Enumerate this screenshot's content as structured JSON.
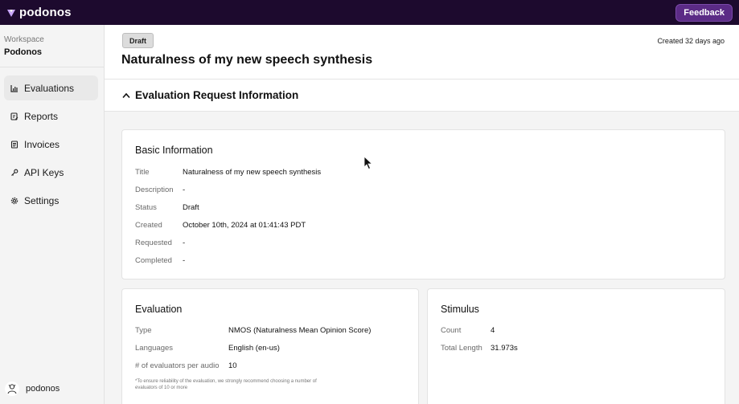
{
  "app": {
    "logo_text": "podonos",
    "feedback_label": "Feedback"
  },
  "sidebar": {
    "workspace_label": "Workspace",
    "workspace_name": "Podonos",
    "items": [
      {
        "label": "Evaluations",
        "icon": "chart-icon",
        "active": true
      },
      {
        "label": "Reports",
        "icon": "report-icon",
        "active": false
      },
      {
        "label": "Invoices",
        "icon": "invoice-icon",
        "active": false
      },
      {
        "label": "API Keys",
        "icon": "key-icon",
        "active": false
      },
      {
        "label": "Settings",
        "icon": "gear-icon",
        "active": false
      }
    ],
    "user_name": "podonos"
  },
  "header": {
    "status_badge": "Draft",
    "created_ago": "Created 32 days ago",
    "title": "Naturalness of my new speech synthesis"
  },
  "section": {
    "title": "Evaluation Request Information"
  },
  "basic_info": {
    "heading": "Basic Information",
    "rows": [
      {
        "label": "Title",
        "value": "Naturalness of my new speech synthesis"
      },
      {
        "label": "Description",
        "value": "-"
      },
      {
        "label": "Status",
        "value": "Draft"
      },
      {
        "label": "Created",
        "value": "October 10th, 2024 at 01:41:43 PDT"
      },
      {
        "label": "Requested",
        "value": "-"
      },
      {
        "label": "Completed",
        "value": "-"
      }
    ]
  },
  "evaluation": {
    "heading": "Evaluation",
    "rows": [
      {
        "label": "Type",
        "value": "NMOS (Naturalness Mean Opinion Score)"
      },
      {
        "label": "Languages",
        "value": "English (en-us)"
      },
      {
        "label": "# of evaluators per audio",
        "value": "10"
      }
    ],
    "note": "*To ensure reliability of the evaluation, we strongly recommend choosing a number of evaluators of 10 or more"
  },
  "stimulus": {
    "heading": "Stimulus",
    "rows": [
      {
        "label": "Count",
        "value": "4"
      },
      {
        "label": "Total Length",
        "value": "31.973s"
      }
    ]
  },
  "colors": {
    "topbar": "#1d0a2e",
    "feedback": "#5b2b86"
  }
}
